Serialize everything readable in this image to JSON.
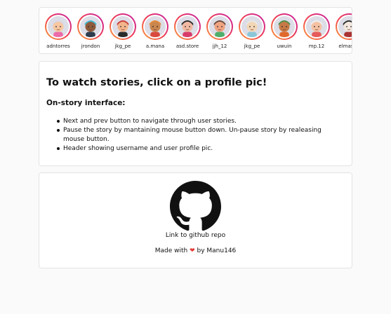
{
  "stories": [
    {
      "username": "adntorres",
      "skin": "#f7c7a1",
      "hair": "#d8d8e8",
      "accent": "#ec6ba8"
    },
    {
      "username": "jrondon",
      "skin": "#8d5a3b",
      "hair": "#47b9d6",
      "accent": "#2f3b4d"
    },
    {
      "username": "jkg_pe",
      "skin": "#f2b48a",
      "hair": "#c73b3b",
      "accent": "#2b2b2b"
    },
    {
      "username": "a.mana",
      "skin": "#c9864e",
      "hair": "#e58b3b",
      "accent": "#d94a3c"
    },
    {
      "username": "asd.store",
      "skin": "#f1b9a2",
      "hair": "#2a2a2a",
      "accent": "#d93b6b"
    },
    {
      "username": "jjh_12",
      "skin": "#f0a482",
      "hair": "#6a4a3a",
      "accent": "#4faf6a"
    },
    {
      "username": "jkg_pe",
      "skin": "#f3d7b5",
      "hair": "#e9e9e9",
      "accent": "#8bc6d8"
    },
    {
      "username": "uwuin",
      "skin": "#c67a46",
      "hair": "#4a8f4a",
      "accent": "#e0692b"
    },
    {
      "username": "mp.12",
      "skin": "#f5c2a4",
      "hair": "#f0f0f0",
      "accent": "#e75b5b"
    },
    {
      "username": "elmasca",
      "skin": "#f4e8de",
      "hair": "#2c2c2c",
      "accent": "#a33"
    }
  ],
  "info": {
    "heading": "To watch stories, click on a profile pic!",
    "subheading": "On-story interface:",
    "bullets": [
      "Next and prev button to navigate through user stories.",
      "Pause the story by mantaining mouse button down. Un-pause story by realeasing mouse button.",
      "Header showing username and user profile pic."
    ]
  },
  "footer": {
    "github_link_label": "Link to github repo",
    "made_with_prefix": "Made with",
    "heart_icon": "heart-icon",
    "made_with_suffix": "by Manu146"
  }
}
